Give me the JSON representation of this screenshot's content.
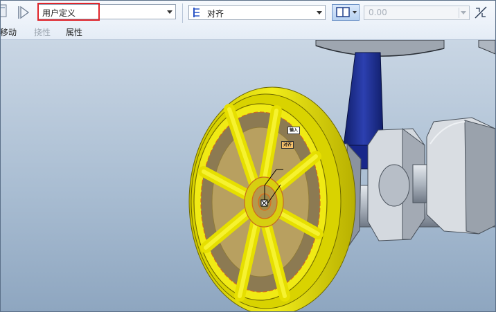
{
  "toolbar": {
    "constraint_set_value": "用户定义",
    "constraint_type_value": "对齐",
    "offset_placeholder": "0.00"
  },
  "tabs": [
    {
      "label": "移动",
      "enabled": true
    },
    {
      "label": "挠性",
      "enabled": false
    },
    {
      "label": "属性",
      "enabled": true
    }
  ],
  "model": {
    "label_input": "输入",
    "label_align": "对齐"
  },
  "colors": {
    "highlight_red": "#e0242a",
    "wheel_yellow": "#e5e000",
    "rod_blue": "#1c2d8c",
    "viewport_top": "#c9d6e4",
    "viewport_bottom": "#8ea6c0"
  },
  "icons": [
    "placement-icon",
    "flip-arrow-icon",
    "constraint-type-icon",
    "split-view-icon",
    "flip-constraint-icon"
  ]
}
